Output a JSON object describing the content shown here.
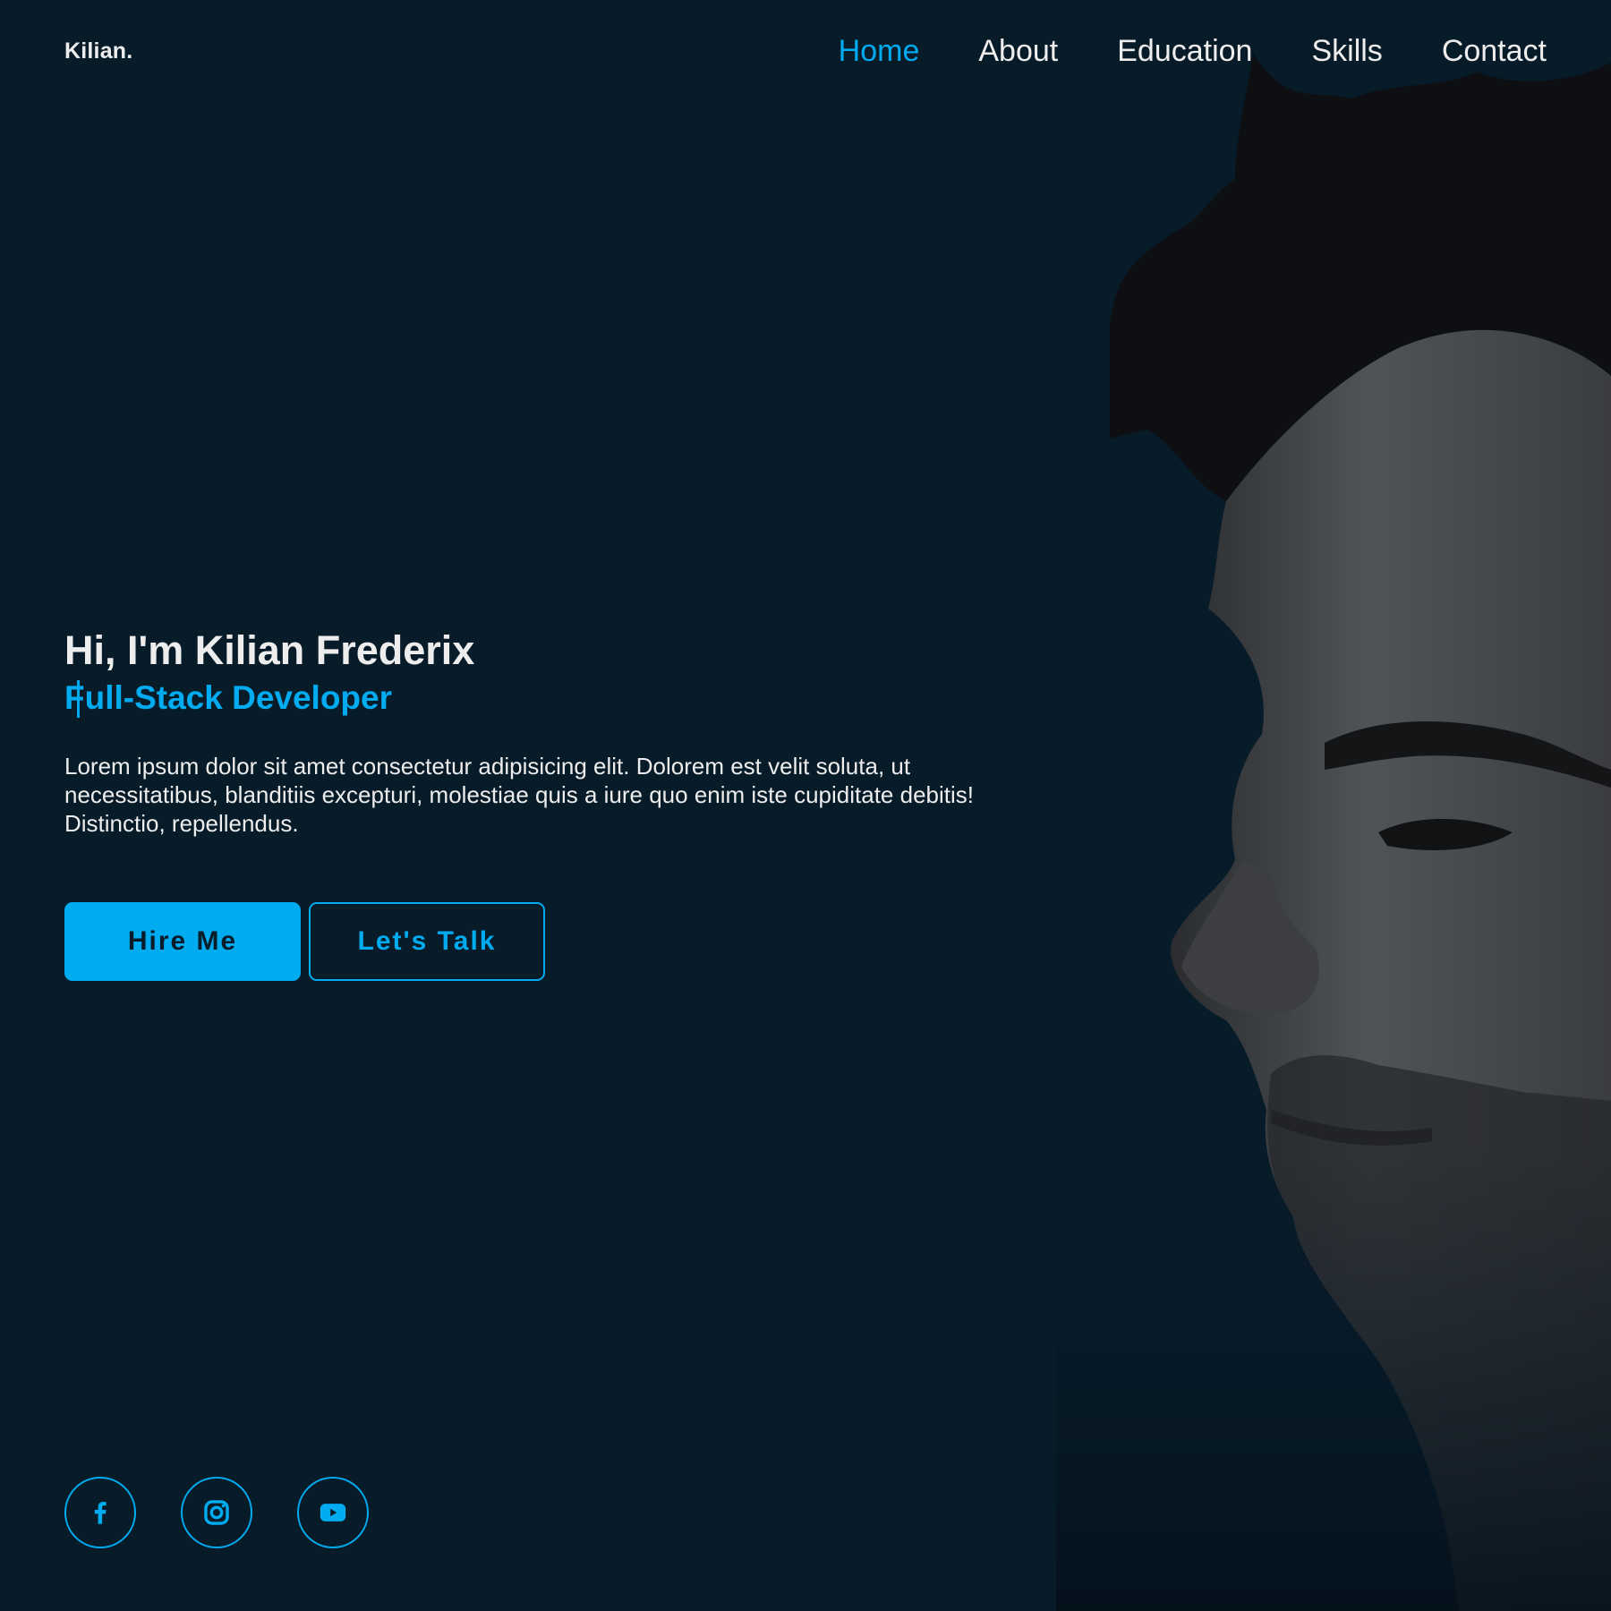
{
  "header": {
    "logo": "Kilian.",
    "nav": [
      {
        "label": "Home",
        "active": true
      },
      {
        "label": "About",
        "active": false
      },
      {
        "label": "Education",
        "active": false
      },
      {
        "label": "Skills",
        "active": false
      },
      {
        "label": "Contact",
        "active": false
      }
    ]
  },
  "hero": {
    "greeting": "Hi, I'm Kilian Frederix",
    "role": "Full-Stack Developer",
    "description": "Lorem ipsum dolor sit amet consectetur adipisicing elit. Dolorem est velit soluta, ut necessitatibus, blanditiis excepturi, molestiae quis a iure quo enim iste cupiditate debitis! Distinctio, repellendus.",
    "buttons": {
      "primary": "Hire Me",
      "secondary": "Let's Talk"
    }
  },
  "socials": [
    {
      "icon": "facebook-icon"
    },
    {
      "icon": "instagram-icon"
    },
    {
      "icon": "youtube-icon"
    }
  ],
  "colors": {
    "background": "#081b29",
    "accent": "#00abf0",
    "text": "#ededed"
  }
}
